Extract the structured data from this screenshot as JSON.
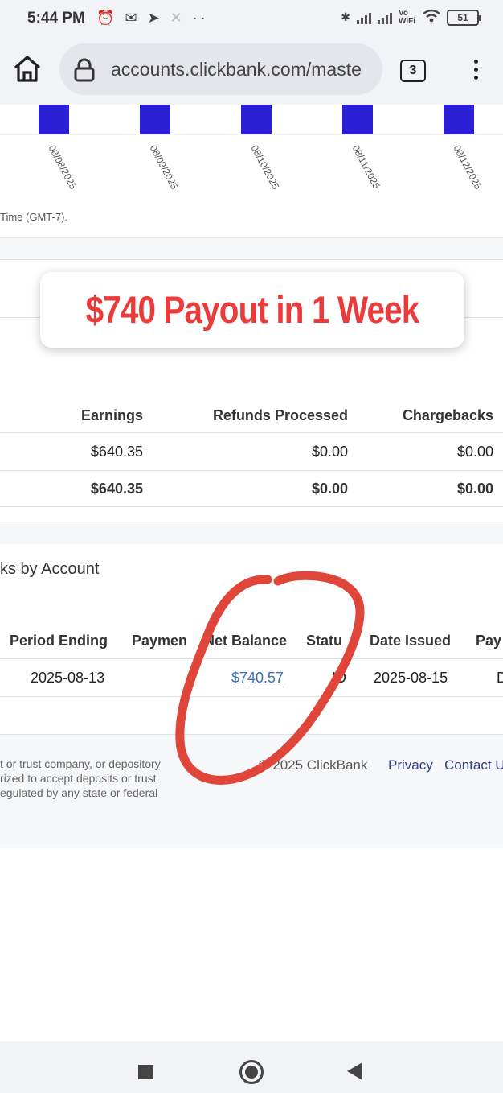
{
  "status_bar": {
    "time": "5:44 PM",
    "icons": [
      "alarm-icon",
      "gmail-icon",
      "telegram-icon",
      "x-icon",
      "more-dots-icon"
    ],
    "right_icons": [
      "bluetooth-icon",
      "signal-icon",
      "signal-icon",
      "vowifi-icon",
      "wifi-icon"
    ],
    "vowifi": "Vo WiFi",
    "battery": "51"
  },
  "browser": {
    "url": "accounts.clickbank.com/maste",
    "tab_count": "3"
  },
  "chart": {
    "accent": "#2a1fd4",
    "bar_heights": [
      1,
      1,
      1,
      1,
      1
    ],
    "labels": [
      "08/08/2025",
      "08/09/2025",
      "08/10/2025",
      "08/11/2025",
      "08/12/2025"
    ],
    "timezone_note": "Time (GMT-7)."
  },
  "overlay": {
    "text": "$740 Payout in 1 Week",
    "color": "#ea3a3a"
  },
  "summary_table": {
    "headers": [
      "Earnings",
      "Refunds Processed",
      "Chargebacks"
    ],
    "rows": [
      [
        "$640.35",
        "$0.00",
        "$0.00"
      ],
      [
        "$640.35",
        "$0.00",
        "$0.00"
      ]
    ]
  },
  "checks_section": {
    "title": "ks by Account",
    "headers": [
      "Period Ending",
      "Paymen",
      "Net Balance",
      "Statu",
      "Date Issued",
      "Pay"
    ],
    "row": {
      "period_ending": "2025-08-13",
      "net_balance": "$740.57",
      "status": "ID",
      "date_issued": "2025-08-15",
      "trailing": "D"
    }
  },
  "footer": {
    "lines": [
      "t or trust company, or depository",
      "rized to accept deposits or trust",
      "egulated by any state or federal"
    ],
    "copyright": "2025 ClickBank",
    "links": [
      "Privacy",
      "Contact U"
    ]
  }
}
